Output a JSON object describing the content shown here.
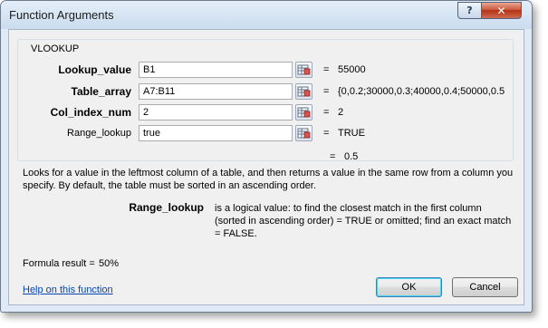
{
  "window": {
    "title": "Function Arguments",
    "help_glyph": "?",
    "close_glyph": "✕"
  },
  "function_name": "VLOOKUP",
  "arguments": [
    {
      "label": "Lookup_value",
      "input": "B1",
      "result": "55000",
      "required": true
    },
    {
      "label": "Table_array",
      "input": "A7:B11",
      "result": "{0,0.2;30000,0.3;40000,0.4;50000,0.5",
      "required": true
    },
    {
      "label": "Col_index_num",
      "input": "2",
      "result": "2",
      "required": true
    },
    {
      "label": "Range_lookup",
      "input": "true",
      "result": "TRUE",
      "required": false
    }
  ],
  "equals_sign": "=",
  "function_result": "0.5",
  "description": "Looks for a value in the leftmost column of a table, and then returns a value in the same row from a column you specify. By default, the table must be sorted in an ascending order.",
  "argument_help": {
    "name": "Range_lookup",
    "text": "is a logical value: to find the closest match in the first column (sorted in ascending order) = TRUE or omitted; find an exact match = FALSE."
  },
  "formula_result": {
    "label": "Formula result =",
    "value": "50%"
  },
  "help_link": "Help on this function",
  "buttons": {
    "ok": "OK",
    "cancel": "Cancel"
  }
}
